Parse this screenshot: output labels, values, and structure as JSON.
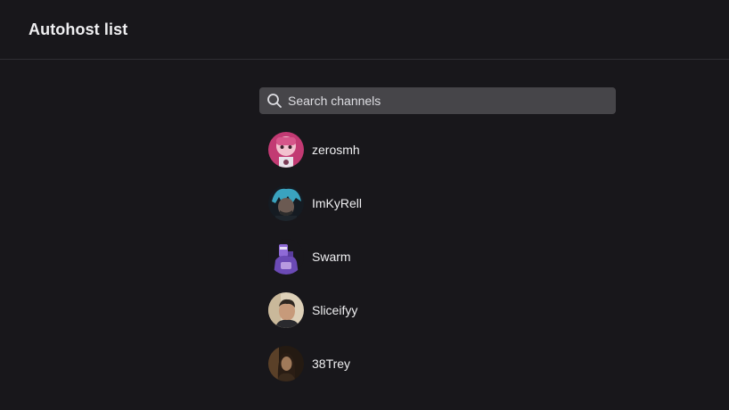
{
  "header": {
    "title": "Autohost list"
  },
  "search": {
    "placeholder": "Search channels",
    "value": "",
    "icon": "search-icon"
  },
  "channels": [
    {
      "name": "zerosmh",
      "avatar_colors": [
        "#c23a73",
        "#f0b9c9"
      ]
    },
    {
      "name": "ImKyRell",
      "avatar_colors": [
        "#2f8fa8",
        "#1b2430"
      ]
    },
    {
      "name": "Swarm",
      "avatar_colors": [
        "#6b4ab5",
        "#b79ae0"
      ]
    },
    {
      "name": "Sliceifyy",
      "avatar_colors": [
        "#d9c7a9",
        "#4b3a2c"
      ]
    },
    {
      "name": "38Trey",
      "avatar_colors": [
        "#3a2a1c",
        "#8a6a4a"
      ]
    }
  ],
  "colors": {
    "background": "#18171b",
    "search_bg": "#464549",
    "text": "#efeff1"
  }
}
